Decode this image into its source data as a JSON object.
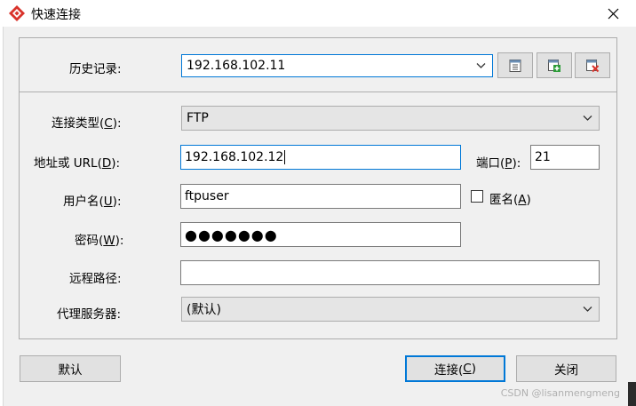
{
  "window": {
    "title": "快速连接",
    "close_symbol": "✕"
  },
  "history": {
    "label_text": "历史记录:",
    "selected_value": "192.168.102.11"
  },
  "form": {
    "connection_type": {
      "label": "连接类型(",
      "accel": "C",
      "label_end": "):",
      "value": "FTP"
    },
    "address": {
      "label": "地址或 URL(",
      "accel": "D",
      "label_end": "):",
      "value": "192.168.102.12"
    },
    "port": {
      "label": "端口(",
      "accel": "P",
      "label_end": "):",
      "value": "21"
    },
    "username": {
      "label": "用户名(",
      "accel": "U",
      "label_end": "):",
      "value": "ftpuser"
    },
    "anonymous": {
      "label": "匿名(",
      "accel": "A",
      "label_end": ")",
      "checked": false
    },
    "password": {
      "label": "密码(",
      "accel": "W",
      "label_end": "):",
      "masked_value": "●●●●●●●"
    },
    "remote_path": {
      "label": "远程路径:",
      "value": ""
    },
    "proxy": {
      "label": "代理服务器:",
      "value": "(默认)"
    }
  },
  "buttons": {
    "default": "默认",
    "connect_prefix": "连接(",
    "connect_accel": "C",
    "connect_suffix": ")",
    "close": "关闭"
  },
  "watermark": "CSDN @lisanmengmeng",
  "colors": {
    "accent": "#0078d7",
    "app_icon": "#d9332b",
    "add_icon": "#2e9c3a",
    "delete_icon": "#d9332b"
  },
  "icons": [
    "app-logo-icon",
    "close-icon",
    "chevron-down-icon",
    "history-properties-icon",
    "history-add-icon",
    "history-delete-icon"
  ]
}
